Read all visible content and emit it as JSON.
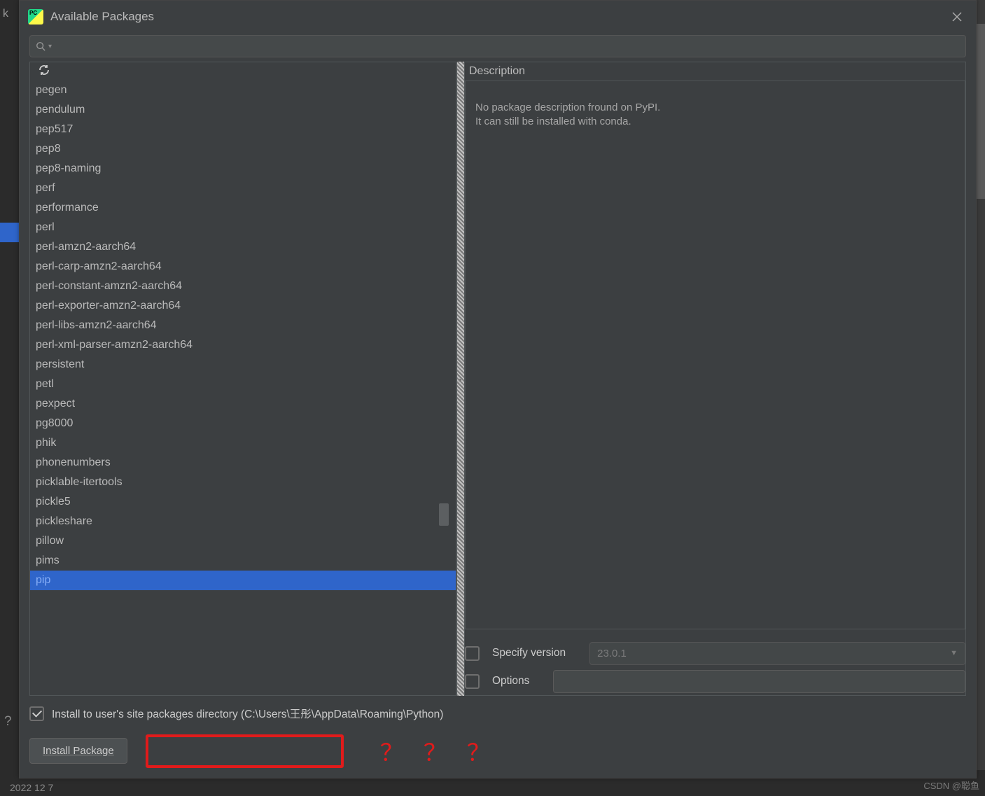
{
  "dialog": {
    "title": "Available Packages",
    "close_tooltip": "Close"
  },
  "search": {
    "placeholder": ""
  },
  "packages": {
    "items": [
      "pegen",
      "pendulum",
      "pep517",
      "pep8",
      "pep8-naming",
      "perf",
      "performance",
      "perl",
      "perl-amzn2-aarch64",
      "perl-carp-amzn2-aarch64",
      "perl-constant-amzn2-aarch64",
      "perl-exporter-amzn2-aarch64",
      "perl-libs-amzn2-aarch64",
      "perl-xml-parser-amzn2-aarch64",
      "persistent",
      "petl",
      "pexpect",
      "pg8000",
      "phik",
      "phonenumbers",
      "picklable-itertools",
      "pickle5",
      "pickleshare",
      "pillow",
      "pims",
      "pip"
    ],
    "selected": "pip"
  },
  "description": {
    "header": "Description",
    "line1": "No package description fround on PyPI.",
    "line2": "It can still be installed with conda."
  },
  "options": {
    "specify_version_label": "Specify version",
    "specify_version_value": "23.0.1",
    "options_label": "Options",
    "options_value": ""
  },
  "install_site": {
    "checked": true,
    "label": "Install to user's site packages directory (C:\\Users\\王彤\\AppData\\Roaming\\Python)"
  },
  "buttons": {
    "install": "Install Package"
  },
  "annotation": {
    "marks": "？？？"
  },
  "backdrop": {
    "date": "2022 12 7",
    "left_char": "k"
  },
  "watermark": "CSDN @聪鱼"
}
